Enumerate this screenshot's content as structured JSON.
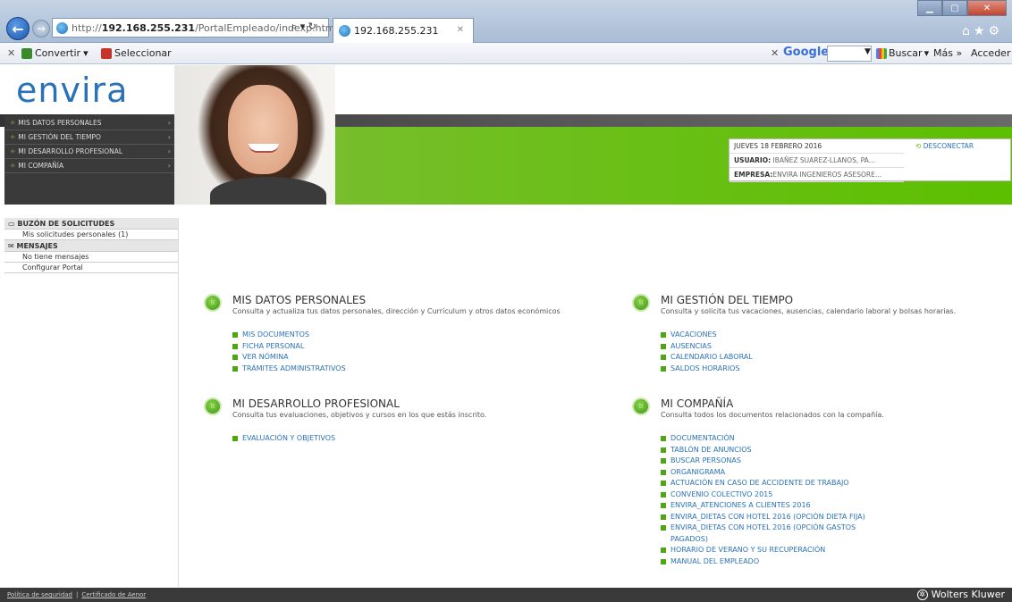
{
  "browser": {
    "url_prefix": "http://",
    "url_host": "192.168.255.231",
    "url_path": "/PortalEmpleado/indexp.html",
    "addr_actions": "⌕ ▾ ↻",
    "tab_title": "192.168.255.231",
    "toolbar": {
      "convertir": "Convertir",
      "seleccionar": "Seleccionar",
      "google": "Google",
      "buscar": "Buscar",
      "mas": "Más »",
      "acceder": "Acceder"
    }
  },
  "header": {
    "logo": "envira",
    "nav": [
      "MIS DATOS PERSONALES",
      "MI GESTIÓN DEL TIEMPO",
      "MI DESARROLLO PROFESIONAL",
      "MI COMPAÑÍA"
    ],
    "date": "JUEVES 18 FEBRERO 2016",
    "user_label": "USUARIO:",
    "user_value": "IBAÑEZ SUAREZ-LLANOS, PA...",
    "company_label": "EMPRESA:",
    "company_value": "ENVIRA INGENIEROS ASESORE...",
    "logout": "DESCONECTAR"
  },
  "left_panel": {
    "inbox_title": "BUZÓN DE SOLICITUDES",
    "inbox_item": "Mis solicitudes personales (1)",
    "messages_title": "MENSAJES",
    "messages_item": "No tiene mensajes",
    "config": "Configurar Portal"
  },
  "sections": {
    "personal": {
      "title": "MIS DATOS PERSONALES",
      "desc": "Consulta y actualiza tus datos personales, dirección y Currículum y otros datos económicos",
      "links": [
        "MIS DOCUMENTOS",
        "FICHA PERSONAL",
        "VER NÓMINA",
        "TRÁMITES ADMINISTRATIVOS"
      ]
    },
    "time": {
      "title": "MI GESTIÓN DEL TIEMPO",
      "desc": "Consulta y solicita tus vacaciones, ausencias, calendario laboral y bolsas horarias.",
      "links": [
        "VACACIONES",
        "AUSENCIAS",
        "CALENDARIO LABORAL",
        "SALDOS HORARIOS"
      ]
    },
    "development": {
      "title": "MI DESARROLLO PROFESIONAL",
      "desc": "Consulta tus evaluaciones, objetivos y cursos en los que estás inscrito.",
      "links": [
        "EVALUACIÓN Y OBJETIVOS"
      ]
    },
    "company": {
      "title": "MI COMPAÑÍA",
      "desc": "Consulta todos los documentos relacionados con la compañía.",
      "links": [
        "DOCUMENTACIÓN",
        "TABLÓN DE ANUNCIOS",
        "BUSCAR PERSONAS",
        "ORGANIGRAMA",
        "ACTUACIÓN EN CASO DE ACCIDENTE DE TRABAJO",
        "CONVENIO COLECTIVO 2015",
        "ENVIRA_ATENCIONES A CLIENTES 2016",
        "ENVIRA_DIETAS CON HOTEL 2016 (OPCIÓN DIETA FIJA)",
        "ENVIRA_DIETAS CON HOTEL 2016 (OPCIÓN GASTOS PAGADOS)",
        "HORARIO DE VERANO Y SU RECUPERACIÓN",
        "MANUAL DEL EMPLEADO"
      ]
    }
  },
  "footer": {
    "security": "Política de seguridad",
    "separator": "|",
    "certificate": "Certificado de Aenor",
    "brand": "Wolters Kluwer"
  },
  "colors": {
    "brand_blue": "#2a72b8",
    "brand_green": "#5cbf00",
    "dark_band": "#3a3a3a"
  }
}
